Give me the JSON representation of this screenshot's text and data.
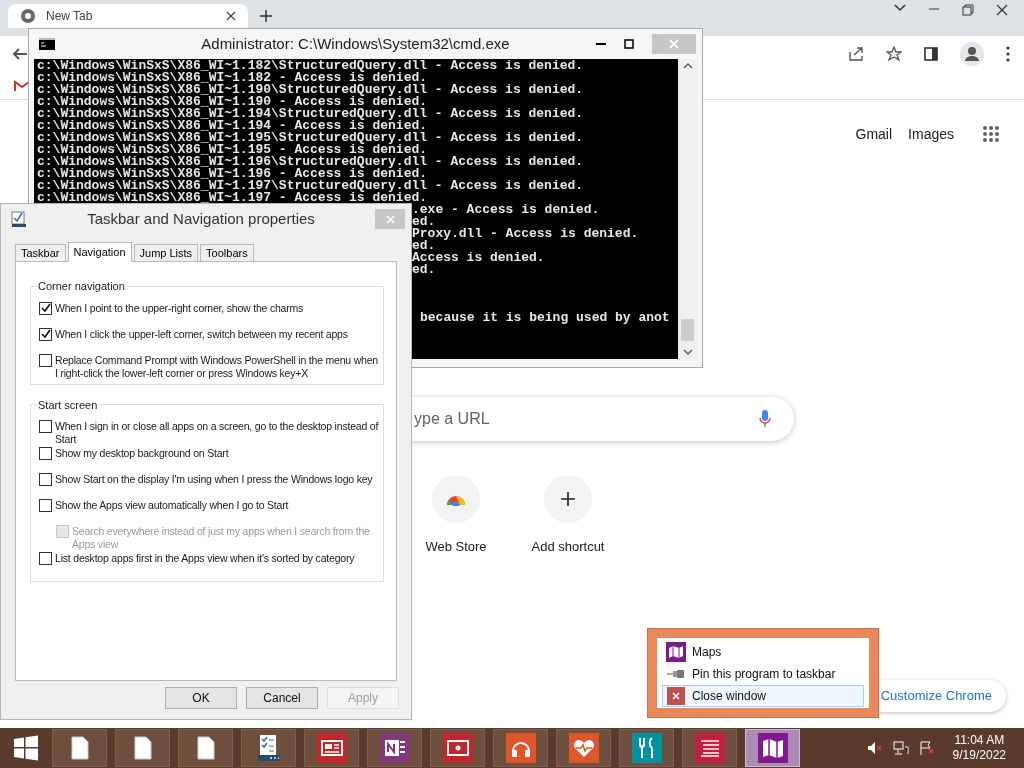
{
  "browser": {
    "tab": {
      "title": "New Tab"
    },
    "header_links": [
      "Gmail",
      "Images"
    ],
    "search": {
      "placeholder": "ype a URL"
    },
    "shortcuts": [
      {
        "label": "Web Store",
        "kind": "store"
      },
      {
        "label": "Add shortcut",
        "kind": "add"
      }
    ],
    "customize_button": "Customize Chrome"
  },
  "cmd": {
    "title": "Administrator: C:\\Windows\\System32\\cmd.exe",
    "lines": [
      "c:\\Windows\\WinSxS\\X86_WI~1.182\\StructuredQuery.dll - Access is denied.",
      "c:\\Windows\\WinSxS\\X86_WI~1.182 - Access is denied.",
      "c:\\Windows\\WinSxS\\X86_WI~1.190\\StructuredQuery.dll - Access is denied.",
      "c:\\Windows\\WinSxS\\X86_WI~1.190 - Access is denied.",
      "c:\\Windows\\WinSxS\\X86_WI~1.194\\StructuredQuery.dll - Access is denied.",
      "c:\\Windows\\WinSxS\\X86_WI~1.194 - Access is denied.",
      "c:\\Windows\\WinSxS\\X86_WI~1.195\\StructuredQuery.dll - Access is denied.",
      "c:\\Windows\\WinSxS\\X86_WI~1.195 - Access is denied.",
      "c:\\Windows\\WinSxS\\X86_WI~1.196\\StructuredQuery.dll - Access is denied.",
      "c:\\Windows\\WinSxS\\X86_WI~1.196 - Access is denied.",
      "c:\\Windows\\WinSxS\\X86_WI~1.197\\StructuredQuery.dll - Access is denied.",
      "c:\\Windows\\WinSxS\\X86_WI~1.197 - Access is denied."
    ],
    "partial_lines": [
      ".exe - Access is denied.",
      "ed.",
      "Proxy.dll - Access is denied.",
      "ed.",
      "Access is denied.",
      "ed."
    ],
    "last_line": "because it is being used by anot"
  },
  "dialog": {
    "title": "Taskbar and Navigation properties",
    "tabs": [
      {
        "label": "Taskbar",
        "selected": false
      },
      {
        "label": "Navigation",
        "selected": true
      },
      {
        "label": "Jump Lists",
        "selected": false
      },
      {
        "label": "Toolbars",
        "selected": false
      }
    ],
    "groups": [
      {
        "title": "Corner navigation",
        "options": [
          {
            "label": "When I point to the upper-right corner, show the charms",
            "checked": true,
            "disabled": false
          },
          {
            "label": "When I click the upper-left corner, switch between my recent apps",
            "checked": true,
            "disabled": false
          },
          {
            "label": "Replace Command Prompt with Windows PowerShell in the menu when I right-click the lower-left corner or press Windows key+X",
            "checked": false,
            "disabled": false
          }
        ]
      },
      {
        "title": "Start screen",
        "options": [
          {
            "label": "When I sign in or close all apps on a screen, go to the desktop instead of Start",
            "checked": false,
            "disabled": false
          },
          {
            "label": "Show my desktop background on Start",
            "checked": false,
            "disabled": false
          },
          {
            "label": "Show Start on the display I'm using when I press the Windows logo key",
            "checked": false,
            "disabled": false
          },
          {
            "label": "Show the Apps view automatically when I go to Start",
            "checked": false,
            "disabled": false,
            "children": [
              {
                "label": "Search everywhere instead of just my apps when I search from the Apps view",
                "checked": false,
                "disabled": true
              }
            ]
          },
          {
            "label": "List desktop apps first in the Apps view when it's sorted by category",
            "checked": false,
            "disabled": false
          }
        ]
      }
    ],
    "buttons": [
      {
        "label": "OK",
        "disabled": false
      },
      {
        "label": "Cancel",
        "disabled": false
      },
      {
        "label": "Apply",
        "disabled": true
      }
    ]
  },
  "jump_list": {
    "items": [
      {
        "label": "Maps",
        "kind": "app",
        "selected": false
      },
      {
        "label": "Pin this program to taskbar",
        "kind": "pin",
        "selected": false
      },
      {
        "label": "Close window",
        "kind": "close",
        "selected": true
      }
    ]
  },
  "taskbar": {
    "apps": [
      {
        "kind": "file",
        "selected": false
      },
      {
        "kind": "file",
        "selected": false
      },
      {
        "kind": "file",
        "selected": false
      },
      {
        "kind": "checklist",
        "selected": false
      },
      {
        "kind": "news",
        "color": "#c1272d",
        "selected": false
      },
      {
        "kind": "notebook",
        "color": "#80397b",
        "selected": false
      },
      {
        "kind": "video",
        "color": "#c1272d",
        "selected": false
      },
      {
        "kind": "music",
        "color": "#e0562b",
        "selected": false
      },
      {
        "kind": "health",
        "color": "#e0562b",
        "selected": false
      },
      {
        "kind": "food",
        "color": "#00929f",
        "selected": false
      },
      {
        "kind": "reading",
        "color": "#c41f3e",
        "selected": false
      },
      {
        "kind": "map",
        "color": "#80198e",
        "selected": true
      }
    ],
    "clock": {
      "time": "11:04 AM",
      "date": "9/19/2022"
    }
  }
}
